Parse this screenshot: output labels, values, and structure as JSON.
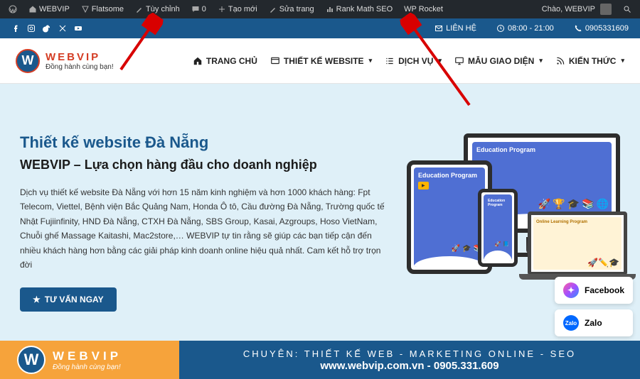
{
  "adminbar": {
    "items": [
      {
        "label": "WEBVIP"
      },
      {
        "label": "Flatsome"
      },
      {
        "label": "Tùy chỉnh"
      },
      {
        "label": "0"
      },
      {
        "label": "Tạo mới"
      },
      {
        "label": "Sửa trang"
      },
      {
        "label": "Rank Math SEO"
      },
      {
        "label": "WP Rocket"
      }
    ],
    "greeting": "Chào, WEBVIP"
  },
  "topbar": {
    "contact_label": "LIÊN HỆ",
    "hours": "08:00 - 21:00",
    "phone": "0905331609"
  },
  "header": {
    "brand": "WEBVIP",
    "tagline": "Đồng hành cùng bạn!",
    "nav": [
      {
        "label": "TRANG CHỦ"
      },
      {
        "label": "THIẾT KẾ WEBSITE"
      },
      {
        "label": "DỊCH VỤ"
      },
      {
        "label": "MẪU GIAO DIỆN"
      },
      {
        "label": "KIẾN THỨC"
      }
    ]
  },
  "hero": {
    "title": "Thiết kế website Đà Nẵng",
    "subtitle": "WEBVIP – Lựa chọn hàng đầu cho doanh nghiệp",
    "desc": "Dịch vụ thiết kế website Đà Nẵng với hơn 15 năm kinh nghiệm và hơn 1000 khách hàng: Fpt Telecom, Viettel, Bệnh viện Bắc Quảng Nam, Honda Ô tô, Cầu đường Đà Nẵng, Trường quốc tế Nhật Fujiinfinity, HND Đà Nẵng, CTXH Đà Nẵng, SBS Group, Kasai, Azgroups, Hoso VietNam, Chuỗi ghế Massage Kaitashi, Mac2store,… WEBVIP tự tin rằng sẽ giúp các bạn tiếp cận đến nhiều khách hàng hơn bằng các giải pháp kinh doanh online hiệu quả nhất. Cam kết hỗ trợ trọn đời",
    "cta": "TƯ VẤN NGAY"
  },
  "widgets": {
    "facebook": "Facebook",
    "zalo": "Zalo"
  },
  "footer": {
    "brand": "WEBVIP",
    "tagline": "Đồng hành cùng bạn!",
    "line1": "CHUYÊN: THIẾT KẾ WEB - MARKETING ONLINE - SEO",
    "line2": "www.webvip.com.vn - 0905.331.609"
  },
  "devices": {
    "card_title": "Education Program",
    "laptop_title": "Online Learning Program"
  }
}
